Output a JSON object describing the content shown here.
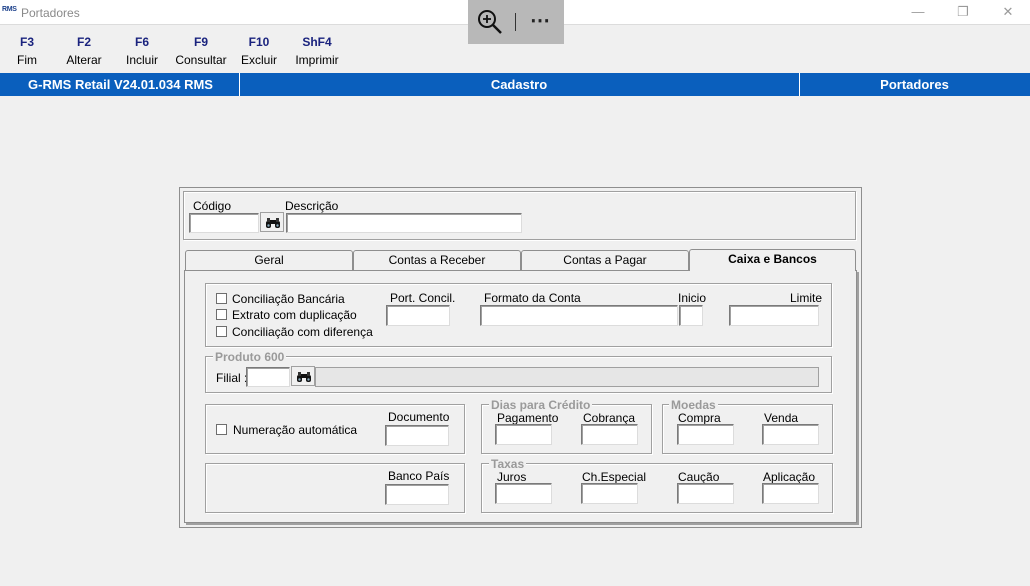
{
  "window": {
    "logo_text": "RMS",
    "title": "Portadores",
    "minimize": "—",
    "restore": "❐",
    "close": "✕"
  },
  "zoombar": {
    "zoom_icon": "zoom-in-icon",
    "more": "⋯"
  },
  "function_keys": [
    {
      "key": "F3",
      "label": "Fim"
    },
    {
      "key": "F2",
      "label": "Alterar"
    },
    {
      "key": "F6",
      "label": "Incluir"
    },
    {
      "key": "F9",
      "label": "Consultar"
    },
    {
      "key": "F10",
      "label": "Excluir"
    },
    {
      "key": "ShF4",
      "label": "Imprimir"
    }
  ],
  "statusbar": {
    "app_version": "G-RMS Retail V24.01.034 RMS",
    "module": "Cadastro",
    "screen": "Portadores",
    "bg_color": "#0a5fbd"
  },
  "header": {
    "codigo_label": "Código",
    "codigo_value": "",
    "descricao_label": "Descrição",
    "descricao_value": ""
  },
  "tabs": [
    {
      "label": "Geral",
      "active": false
    },
    {
      "label": "Contas a Receber",
      "active": false
    },
    {
      "label": "Contas a Pagar",
      "active": false
    },
    {
      "label": "Caixa e Bancos",
      "active": true
    }
  ],
  "caixa_bancos": {
    "checkboxes": [
      {
        "label": "Conciliação Bancária",
        "checked": false
      },
      {
        "label": "Extrato com duplicação",
        "checked": false
      },
      {
        "label": "Conciliação com diferença",
        "checked": false
      }
    ],
    "port_concil_label": "Port. Concil.",
    "formato_conta_label": "Formato da Conta",
    "inicio_label": "Inicio",
    "limite_label": "Limite",
    "produto600": {
      "legend": "Produto 600",
      "filial_label": "Filial :",
      "filial_value": "",
      "description_value": ""
    },
    "numeracao_automatica_label": "Numeração automática",
    "documento_label": "Documento",
    "dias_credito": {
      "legend": "Dias para Crédito",
      "pagamento_label": "Pagamento",
      "cobranca_label": "Cobrança"
    },
    "moedas": {
      "legend": "Moedas",
      "compra_label": "Compra",
      "venda_label": "Venda"
    },
    "banco_pais_label": "Banco País",
    "taxas": {
      "legend": "Taxas",
      "juros_label": "Juros",
      "ch_especial_label": "Ch.Especial",
      "caucao_label": "Caução",
      "aplicacao_label": "Aplicação"
    }
  }
}
